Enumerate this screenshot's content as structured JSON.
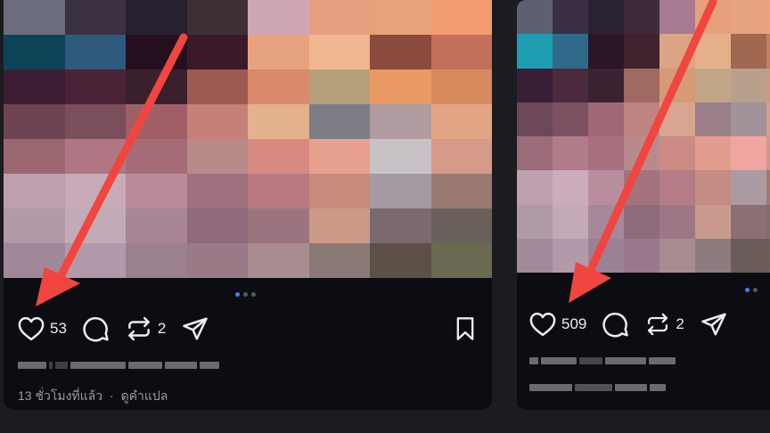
{
  "posts": [
    {
      "likes": "53",
      "reposts": "2",
      "time_ago": "13 ชั่วโมงที่แล้ว",
      "separator": "·",
      "translate": "ดูคำแปล"
    },
    {
      "likes": "509",
      "reposts": "2"
    }
  ],
  "icons": {
    "like": "heart-icon",
    "comment": "comment-icon",
    "repost": "repost-icon",
    "share": "send-icon",
    "save": "bookmark-icon"
  },
  "colors": {
    "annotation_arrow": "#f0463f",
    "active_dot": "#3b82f6",
    "card_background": "#0c0d12",
    "page_background": "#1b1c20"
  }
}
